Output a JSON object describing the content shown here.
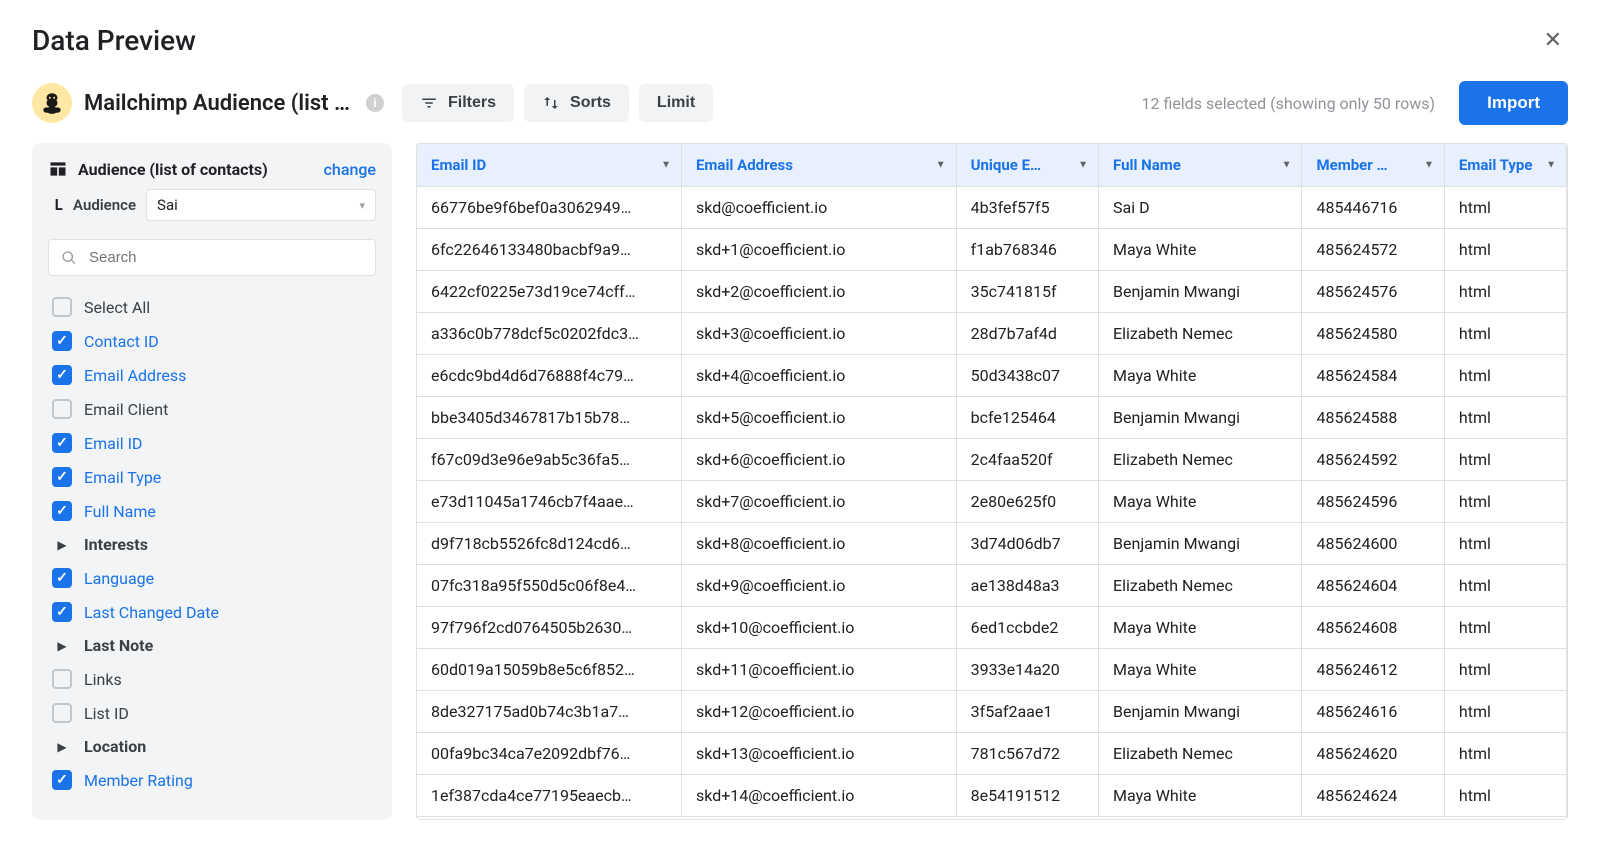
{
  "modal": {
    "title": "Data Preview",
    "close_aria": "Close"
  },
  "source": {
    "name": "Mailchimp Audience (list …",
    "logo_emoji": "🐵"
  },
  "toolbar": {
    "filters": "Filters",
    "sorts": "Sorts",
    "limit": "Limit",
    "summary": "12 fields selected (showing only 50 rows)",
    "import": "Import"
  },
  "sidebar": {
    "title": "Audience (list of contacts)",
    "change_label": "change",
    "sub_label": "Audience",
    "select_value": "Sai",
    "search_placeholder": "Search",
    "fields": [
      {
        "label": "Select All",
        "type": "check",
        "checked": false
      },
      {
        "label": "Contact ID",
        "type": "check",
        "checked": true
      },
      {
        "label": "Email Address",
        "type": "check",
        "checked": true
      },
      {
        "label": "Email Client",
        "type": "check",
        "checked": false
      },
      {
        "label": "Email ID",
        "type": "check",
        "checked": true
      },
      {
        "label": "Email Type",
        "type": "check",
        "checked": true
      },
      {
        "label": "Full Name",
        "type": "check",
        "checked": true
      },
      {
        "label": "Interests",
        "type": "expand"
      },
      {
        "label": "Language",
        "type": "check",
        "checked": true
      },
      {
        "label": "Last Changed Date",
        "type": "check",
        "checked": true
      },
      {
        "label": "Last Note",
        "type": "expand"
      },
      {
        "label": "Links",
        "type": "check",
        "checked": false
      },
      {
        "label": "List ID",
        "type": "check",
        "checked": false
      },
      {
        "label": "Location",
        "type": "expand"
      },
      {
        "label": "Member Rating",
        "type": "check",
        "checked": true
      }
    ]
  },
  "table": {
    "columns": [
      "Email ID",
      "Email Address",
      "Unique E…",
      "Full Name",
      "Member …",
      "Email Type"
    ],
    "rows": [
      [
        "66776be9f6bef0a3062949…",
        "skd@coefficient.io",
        "4b3fef57f5",
        "Sai D",
        "485446716",
        "html"
      ],
      [
        "6fc22646133480bacbf9a9…",
        "skd+1@coefficient.io",
        "f1ab768346",
        "Maya White",
        "485624572",
        "html"
      ],
      [
        "6422cf0225e73d19ce74cff…",
        "skd+2@coefficient.io",
        "35c741815f",
        "Benjamin Mwangi",
        "485624576",
        "html"
      ],
      [
        "a336c0b778dcf5c0202fdc3…",
        "skd+3@coefficient.io",
        "28d7b7af4d",
        "Elizabeth Nemec",
        "485624580",
        "html"
      ],
      [
        "e6cdc9bd4d6d76888f4c79…",
        "skd+4@coefficient.io",
        "50d3438c07",
        "Maya White",
        "485624584",
        "html"
      ],
      [
        "bbe3405d3467817b15b78…",
        "skd+5@coefficient.io",
        "bcfe125464",
        "Benjamin Mwangi",
        "485624588",
        "html"
      ],
      [
        "f67c09d3e96e9ab5c36fa5…",
        "skd+6@coefficient.io",
        "2c4faa520f",
        "Elizabeth Nemec",
        "485624592",
        "html"
      ],
      [
        "e73d11045a1746cb7f4aae…",
        "skd+7@coefficient.io",
        "2e80e625f0",
        "Maya White",
        "485624596",
        "html"
      ],
      [
        "d9f718cb5526fc8d124cd6…",
        "skd+8@coefficient.io",
        "3d74d06db7",
        "Benjamin Mwangi",
        "485624600",
        "html"
      ],
      [
        "07fc318a95f550d5c06f8e4…",
        "skd+9@coefficient.io",
        "ae138d48a3",
        "Elizabeth Nemec",
        "485624604",
        "html"
      ],
      [
        "97f796f2cd0764505b2630…",
        "skd+10@coefficient.io",
        "6ed1ccbde2",
        "Maya White",
        "485624608",
        "html"
      ],
      [
        "60d019a15059b8e5c6f852…",
        "skd+11@coefficient.io",
        "3933e14a20",
        "Maya White",
        "485624612",
        "html"
      ],
      [
        "8de327175ad0b74c3b1a7…",
        "skd+12@coefficient.io",
        "3f5af2aae1",
        "Benjamin Mwangi",
        "485624616",
        "html"
      ],
      [
        "00fa9bc34ca7e2092dbf76…",
        "skd+13@coefficient.io",
        "781c567d72",
        "Elizabeth Nemec",
        "485624620",
        "html"
      ],
      [
        "1ef387cda4ce77195eaecb…",
        "skd+14@coefficient.io",
        "8e54191512",
        "Maya White",
        "485624624",
        "html"
      ]
    ]
  }
}
